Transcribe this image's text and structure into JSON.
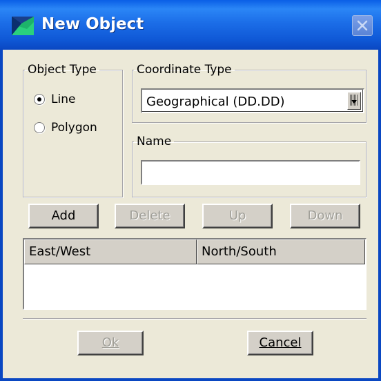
{
  "window": {
    "title": "New Object"
  },
  "object_type": {
    "legend": "Object Type",
    "options": [
      {
        "label": "Line",
        "checked": true
      },
      {
        "label": "Polygon",
        "checked": false
      }
    ]
  },
  "coordinate_type": {
    "legend": "Coordinate Type",
    "selected": "Geographical (DD.DD)"
  },
  "name": {
    "legend": "Name",
    "value": ""
  },
  "buttons": {
    "add": "Add",
    "delete": "Delete",
    "up": "Up",
    "down": "Down"
  },
  "table": {
    "columns": [
      "East/West",
      "North/South"
    ],
    "rows": []
  },
  "footer": {
    "ok": "Ok",
    "cancel": "Cancel"
  },
  "colors": {
    "title_bar": "#1c6ee8",
    "face": "#ece9d8",
    "control": "#d4d0c8"
  }
}
